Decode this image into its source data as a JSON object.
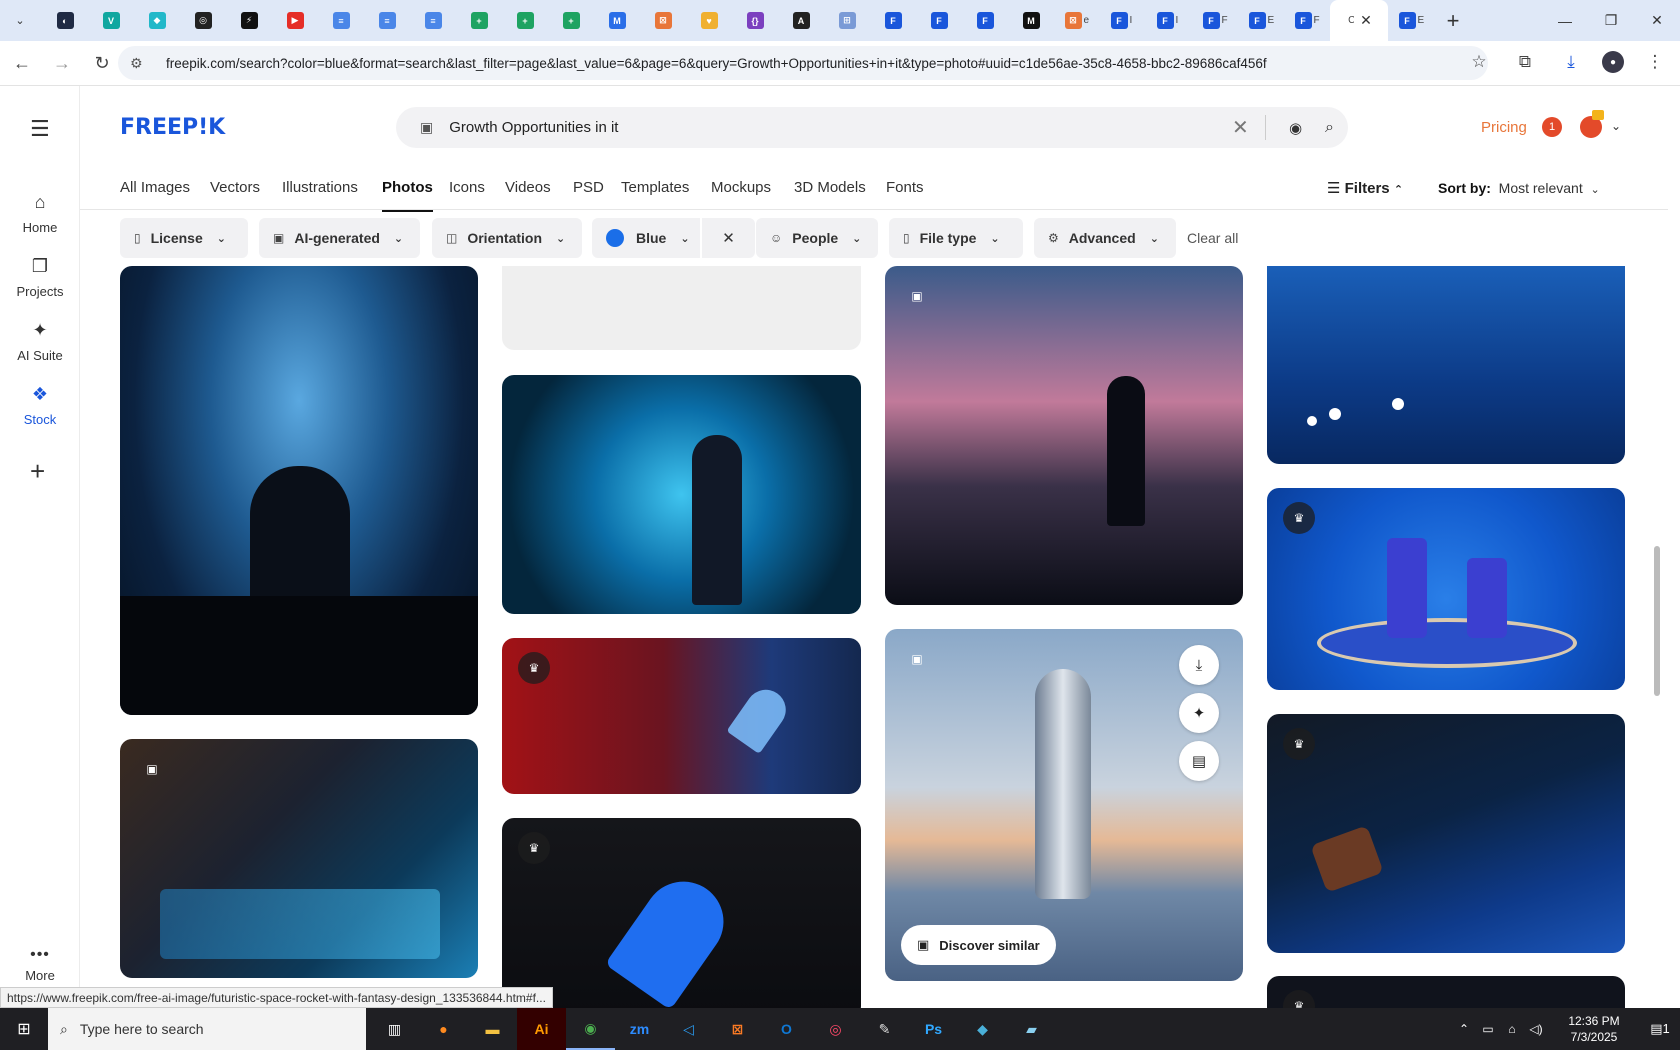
{
  "browser": {
    "tabs": [
      {
        "icon": "generic",
        "color": "#1f2a44",
        "glyph": "◐"
      },
      {
        "icon": "app",
        "color": "#10a7a0",
        "glyph": "V"
      },
      {
        "icon": "app",
        "color": "#22b8c9",
        "glyph": "◆"
      },
      {
        "icon": "openai",
        "color": "#222",
        "glyph": "◎"
      },
      {
        "icon": "app",
        "color": "#111",
        "glyph": "⚡"
      },
      {
        "icon": "youtube",
        "color": "#e52d27",
        "glyph": "▶"
      },
      {
        "icon": "docs",
        "color": "#4a86e8",
        "glyph": "≡"
      },
      {
        "icon": "docs",
        "color": "#4a86e8",
        "glyph": "≡"
      },
      {
        "icon": "docs",
        "color": "#4a86e8",
        "glyph": "≡"
      },
      {
        "icon": "sheets",
        "color": "#1ea362",
        "glyph": "+"
      },
      {
        "icon": "sheets",
        "color": "#1ea362",
        "glyph": "+"
      },
      {
        "icon": "sheets",
        "color": "#1ea362",
        "glyph": "+"
      },
      {
        "icon": "app",
        "color": "#2a6ee8",
        "glyph": "M"
      },
      {
        "icon": "app",
        "color": "#e8763a",
        "glyph": "⊠"
      },
      {
        "icon": "app",
        "color": "#f0b030",
        "glyph": "♥"
      },
      {
        "icon": "app",
        "color": "#7b3fbf",
        "glyph": "{}"
      },
      {
        "icon": "app",
        "color": "#222",
        "glyph": "A"
      },
      {
        "icon": "app",
        "color": "#7a9ad6",
        "glyph": "⊞"
      },
      {
        "icon": "app",
        "color": "#1a56db",
        "glyph": "F"
      },
      {
        "icon": "app",
        "color": "#1a56db",
        "glyph": "F"
      },
      {
        "icon": "app",
        "color": "#1a56db",
        "glyph": "F"
      },
      {
        "icon": "app",
        "color": "#111",
        "glyph": "M"
      },
      {
        "icon": "app",
        "color": "#e8763a",
        "glyph": "⊠",
        "title": "e"
      },
      {
        "icon": "app",
        "color": "#1a56db",
        "glyph": "F",
        "title": "I"
      },
      {
        "icon": "app",
        "color": "#1a56db",
        "glyph": "F",
        "title": "I"
      },
      {
        "icon": "app",
        "color": "#1a56db",
        "glyph": "F",
        "title": "F"
      },
      {
        "icon": "app",
        "color": "#1a56db",
        "glyph": "F",
        "title": "E"
      },
      {
        "icon": "app",
        "color": "#1a56db",
        "glyph": "F",
        "title": "F"
      }
    ],
    "active_tab": {
      "title": "C",
      "close": "✕"
    },
    "after_tab": {
      "color": "#1a56db",
      "glyph": "F",
      "title": "E"
    },
    "new_tab": "+",
    "window_controls": [
      "—",
      "❐",
      "✕"
    ],
    "url": "freepik.com/search?color=blue&format=search&last_filter=page&last_value=6&page=6&query=Growth+Opportunities+in+it&type=photo#uuid=c1de56ae-35c8-4658-bbc2-89686caf456f"
  },
  "site": {
    "logo": "FREEP!K",
    "search_value": "Growth Opportunities in it",
    "pricing": "Pricing",
    "notif_count": "1",
    "sidebar": {
      "home": "Home",
      "projects": "Projects",
      "ai_suite": "AI Suite",
      "stock": "Stock",
      "more": "More"
    },
    "categories": [
      "All Images",
      "Vectors",
      "Illustrations",
      "Photos",
      "Icons",
      "Videos",
      "PSD",
      "Templates",
      "Mockups",
      "3D Models",
      "Fonts"
    ],
    "active_category": "Photos",
    "filters_label": "Filters",
    "sort_label": "Sort by:",
    "sort_value": "Most relevant",
    "chips": {
      "license": "License",
      "ai_generated": "AI-generated",
      "orientation": "Orientation",
      "color": "Blue",
      "people": "People",
      "file_type": "File type",
      "advanced": "Advanced",
      "clear_all": "Clear all"
    },
    "discover_similar": "Discover similar"
  },
  "status_url": "https://www.freepik.com/free-ai-image/futuristic-space-rocket-with-fantasy-design_133536844.htm#f...",
  "taskbar": {
    "search_placeholder": "Type here to search",
    "time": "12:36 PM",
    "date": "7/3/2025",
    "notif": "1"
  }
}
